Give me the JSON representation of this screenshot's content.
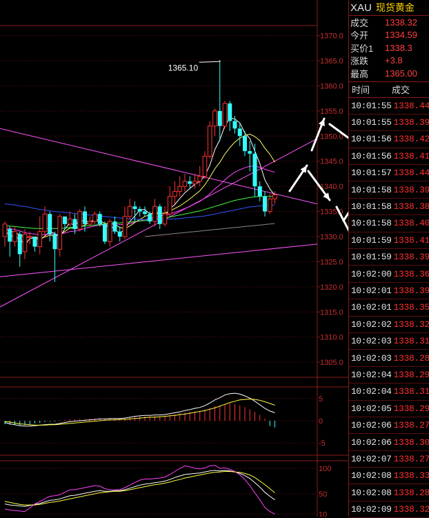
{
  "quote": {
    "symbol": "XAU",
    "name": "现货黄金",
    "rows": [
      {
        "label": "成交",
        "value": "1338.32"
      },
      {
        "label": "今开",
        "value": "1334.59"
      },
      {
        "label": "买价1",
        "value": "1338.3"
      },
      {
        "label": "涨跌",
        "value": "+3.8"
      },
      {
        "label": "最高",
        "value": "1365.00"
      }
    ]
  },
  "ticks": {
    "headers": [
      "时间",
      "成交"
    ],
    "rows": [
      {
        "time": "10:01:55",
        "price": "1338.44"
      },
      {
        "time": "10:01:55",
        "price": "1338.39"
      },
      {
        "time": "10:01:56",
        "price": "1338.42"
      },
      {
        "time": "10:01:56",
        "price": "1338.41"
      },
      {
        "time": "10:01:57",
        "price": "1338.44"
      },
      {
        "time": "10:01:58",
        "price": "1338.39"
      },
      {
        "time": "10:01:58",
        "price": "1338.38"
      },
      {
        "time": "10:01:58",
        "price": "1338.40"
      },
      {
        "time": "10:01:59",
        "price": "1338.41"
      },
      {
        "time": "10:01:59",
        "price": "1338.39"
      },
      {
        "time": "10:02:00",
        "price": "1338.36"
      },
      {
        "time": "10:02:01",
        "price": "1338.39"
      },
      {
        "time": "10:02:01",
        "price": "1338.35"
      },
      {
        "time": "10:02:02",
        "price": "1338.32"
      },
      {
        "time": "10:02:03",
        "price": "1338.31"
      },
      {
        "time": "10:02:03",
        "price": "1338.28"
      },
      {
        "time": "10:02:04",
        "price": "1338.29"
      },
      {
        "time": "10:02:04",
        "price": "1338.31"
      },
      {
        "time": "10:02:05",
        "price": "1338.29"
      },
      {
        "time": "10:02:06",
        "price": "1338.27"
      },
      {
        "time": "10:02:06",
        "price": "1338.30"
      },
      {
        "time": "10:02:07",
        "price": "1338.27"
      },
      {
        "time": "10:02:08",
        "price": "1338.33"
      },
      {
        "time": "10:02:08",
        "price": "1338.28"
      },
      {
        "time": "10:02:09",
        "price": "1338.32"
      }
    ]
  },
  "chart_data": {
    "type": "candlestick",
    "price_axis": {
      "ticks": [
        "1370.0",
        "1365.0",
        "1360.0",
        "1355.0",
        "1350.0",
        "1345.0",
        "1340.0",
        "1335.0",
        "1330.0",
        "1325.0",
        "1320.0",
        "1315.0",
        "1310.0",
        "1305.0"
      ],
      "range": [
        1302,
        1372
      ]
    },
    "high_label": "1365.10",
    "macd_axis": {
      "ticks": [
        "5",
        "0",
        "-5"
      ],
      "range": [
        -7,
        7
      ]
    },
    "kdj_axis": {
      "ticks": [
        "100",
        "50",
        "10"
      ],
      "range": [
        5,
        115
      ]
    },
    "candles": [
      [
        1330.0,
        1332.5,
        1328.0,
        1333.0
      ],
      [
        1331.5,
        1329.0,
        1326.0,
        1332.0
      ],
      [
        1329.0,
        1331.0,
        1328.0,
        1332.0
      ],
      [
        1330.5,
        1326.5,
        1324.0,
        1331.0
      ],
      [
        1327.0,
        1330.5,
        1325.5,
        1331.5
      ],
      [
        1330.0,
        1330.0,
        1328.5,
        1331.0
      ],
      [
        1330.0,
        1328.0,
        1327.0,
        1330.0
      ],
      [
        1328.0,
        1331.0,
        1326.5,
        1334.0
      ],
      [
        1331.0,
        1334.5,
        1330.0,
        1336.0
      ],
      [
        1334.5,
        1330.5,
        1329.0,
        1335.0
      ],
      [
        1330.5,
        1327.5,
        1321.0,
        1331.0
      ],
      [
        1327.5,
        1334.0,
        1326.0,
        1334.5
      ],
      [
        1334.0,
        1332.5,
        1331.5,
        1334.0
      ],
      [
        1332.5,
        1333.5,
        1332.0,
        1335.0
      ],
      [
        1333.5,
        1331.5,
        1330.5,
        1334.5
      ],
      [
        1331.5,
        1335.0,
        1331.0,
        1335.5
      ],
      [
        1335.0,
        1332.5,
        1331.0,
        1336.0
      ],
      [
        1332.5,
        1333.0,
        1332.0,
        1334.0
      ],
      [
        1333.0,
        1334.5,
        1332.5,
        1335.0
      ],
      [
        1334.5,
        1332.5,
        1332.0,
        1335.0
      ],
      [
        1332.5,
        1329.0,
        1328.5,
        1333.0
      ],
      [
        1329.0,
        1333.0,
        1328.0,
        1333.5
      ],
      [
        1333.0,
        1331.0,
        1330.5,
        1334.0
      ],
      [
        1331.0,
        1330.0,
        1329.0,
        1332.0
      ],
      [
        1330.0,
        1334.0,
        1329.5,
        1336.0
      ],
      [
        1334.0,
        1336.0,
        1333.5,
        1337.5
      ],
      [
        1336.0,
        1335.5,
        1333.0,
        1337.0
      ],
      [
        1335.5,
        1335.0,
        1334.0,
        1336.0
      ],
      [
        1335.0,
        1334.5,
        1334.0,
        1336.0
      ],
      [
        1334.5,
        1333.0,
        1332.5,
        1335.0
      ],
      [
        1333.0,
        1336.0,
        1332.0,
        1337.5
      ],
      [
        1336.0,
        1332.5,
        1331.5,
        1336.5
      ],
      [
        1332.5,
        1334.5,
        1332.0,
        1336.0
      ],
      [
        1334.5,
        1338.0,
        1334.0,
        1340.0
      ],
      [
        1338.0,
        1339.0,
        1336.5,
        1341.0
      ],
      [
        1339.0,
        1340.0,
        1338.0,
        1342.0
      ],
      [
        1340.0,
        1341.0,
        1339.0,
        1342.5
      ],
      [
        1341.0,
        1340.5,
        1339.5,
        1342.0
      ],
      [
        1340.5,
        1341.0,
        1339.5,
        1342.5
      ],
      [
        1341.0,
        1342.0,
        1340.0,
        1344.0
      ],
      [
        1342.0,
        1346.0,
        1341.5,
        1347.0
      ],
      [
        1346.0,
        1352.0,
        1345.5,
        1353.0
      ],
      [
        1352.0,
        1355.0,
        1350.0,
        1355.5
      ],
      [
        1355.0,
        1352.0,
        1349.0,
        1365.1
      ],
      [
        1352.0,
        1356.5,
        1351.5,
        1357.0
      ],
      [
        1356.5,
        1353.0,
        1351.0,
        1357.0
      ],
      [
        1353.0,
        1351.5,
        1350.5,
        1354.0
      ],
      [
        1351.5,
        1350.0,
        1348.0,
        1352.5
      ],
      [
        1350.0,
        1347.0,
        1346.0,
        1351.0
      ],
      [
        1347.0,
        1346.5,
        1343.0,
        1349.0
      ],
      [
        1346.5,
        1340.0,
        1338.0,
        1348.5
      ],
      [
        1340.0,
        1338.0,
        1337.0,
        1341.0
      ],
      [
        1338.0,
        1335.0,
        1334.0,
        1339.0
      ],
      [
        1335.0,
        1337.5,
        1334.5,
        1338.5
      ],
      [
        1337.5,
        1338.3,
        1336.5,
        1339.0
      ]
    ],
    "ma_lines": [
      {
        "color": "#ffffff",
        "values": [
          1331.2,
          1330.2,
          1330.0,
          1329.5,
          1328.4,
          1329.6,
          1329.8,
          1329.3,
          1330.1,
          1331.0,
          1330.6,
          1330.0,
          1331.5,
          1332.7,
          1332.2,
          1333.2,
          1333.1,
          1332.9,
          1333.5,
          1333.2,
          1331.8,
          1332.3,
          1331.4,
          1330.6,
          1331.6,
          1333.0,
          1334.1,
          1335.3,
          1335.4,
          1334.5,
          1334.8,
          1334.3,
          1334.1,
          1335.5,
          1336.4,
          1337.6,
          1338.7,
          1339.6,
          1340.4,
          1341.0,
          1342.1,
          1344.2,
          1347.3,
          1349.3,
          1352.0,
          1353.6,
          1353.4,
          1352.6,
          1350.6,
          1349.5,
          1347.0,
          1344.5,
          1341.3,
          1339.5,
          1338.2
        ]
      },
      {
        "color": "#ffff66",
        "values": [
          1331.5,
          1331.2,
          1330.8,
          1330.4,
          1329.9,
          1329.9,
          1329.9,
          1329.6,
          1329.9,
          1330.3,
          1330.1,
          1330.4,
          1331.0,
          1331.7,
          1331.6,
          1331.9,
          1332.3,
          1332.9,
          1333.0,
          1333.2,
          1332.6,
          1332.6,
          1332.4,
          1331.8,
          1331.6,
          1332.1,
          1332.8,
          1333.4,
          1334.0,
          1334.4,
          1334.9,
          1334.6,
          1334.7,
          1335.1,
          1335.6,
          1336.1,
          1336.8,
          1337.5,
          1338.3,
          1339.1,
          1340.3,
          1341.8,
          1343.5,
          1344.8,
          1346.4,
          1347.7,
          1348.8,
          1349.6,
          1350.1,
          1350.4,
          1349.9,
          1349.1,
          1347.6,
          1346.4,
          1344.8
        ]
      },
      {
        "color": "#ff44ff",
        "values": [
          1331.8,
          1331.6,
          1331.4,
          1331.1,
          1330.8,
          1330.6,
          1330.5,
          1330.4,
          1330.4,
          1330.5,
          1330.4,
          1330.5,
          1330.7,
          1331.0,
          1331.1,
          1331.3,
          1331.6,
          1331.9,
          1332.1,
          1332.3,
          1332.3,
          1332.4,
          1332.5,
          1332.4,
          1332.4,
          1332.6,
          1332.9,
          1333.1,
          1333.4,
          1333.6,
          1333.9,
          1334.0,
          1334.2,
          1334.5,
          1334.8,
          1335.2,
          1335.6,
          1336.0,
          1336.5,
          1337.0,
          1337.7,
          1338.5,
          1339.5,
          1340.3,
          1341.3,
          1342.1,
          1342.8,
          1343.3,
          1343.7,
          1344.0,
          1344.0,
          1343.8,
          1343.4,
          1343.1,
          1342.8
        ]
      },
      {
        "color": "#44ff44",
        "values": [
          1332.2,
          1332.1,
          1332.0,
          1331.9,
          1331.8,
          1331.7,
          1331.6,
          1331.6,
          1331.6,
          1331.6,
          1331.6,
          1331.6,
          1331.7,
          1331.8,
          1331.9,
          1332.0,
          1332.1,
          1332.2,
          1332.3,
          1332.4,
          1332.5,
          1332.6,
          1332.7,
          1332.7,
          1332.8,
          1332.9,
          1333.0,
          1333.1,
          1333.2,
          1333.3,
          1333.5,
          1333.6,
          1333.7,
          1333.9,
          1334.1,
          1334.3,
          1334.5,
          1334.7,
          1334.9,
          1335.1,
          1335.4,
          1335.7,
          1336.0,
          1336.3,
          1336.6,
          1336.9,
          1337.2,
          1337.4,
          1337.6,
          1337.8,
          1337.9,
          1338.0,
          1338.0,
          1338.0,
          1338.0
        ]
      },
      {
        "color": "#3355ff",
        "values": [
          1336.5,
          1336.4,
          1336.3,
          1336.1,
          1336.0,
          1335.8,
          1335.6,
          1335.4,
          1335.3,
          1335.1,
          1335.0,
          1334.9,
          1334.8,
          1334.7,
          1334.6,
          1334.5,
          1334.4,
          1334.3,
          1334.2,
          1334.1,
          1334.0,
          1333.9,
          1333.8,
          1333.7,
          1333.6,
          1333.5,
          1333.5,
          1333.4,
          1333.4,
          1333.4,
          1333.4,
          1333.4,
          1333.4,
          1333.5,
          1333.5,
          1333.6,
          1333.7,
          1333.8,
          1333.9,
          1334.0,
          1334.1,
          1334.3,
          1334.5,
          1334.7,
          1334.9,
          1335.1,
          1335.3,
          1335.5,
          1335.7,
          1335.9,
          1336.0,
          1336.1,
          1336.2,
          1336.2,
          1336.3
        ]
      },
      {
        "color": "#888888",
        "values": [
          null,
          null,
          null,
          null,
          null,
          null,
          null,
          null,
          null,
          null,
          null,
          null,
          null,
          null,
          null,
          null,
          null,
          null,
          null,
          null,
          null,
          null,
          null,
          null,
          null,
          null,
          null,
          null,
          1330.0,
          1330.1,
          1330.2,
          1330.3,
          1330.4,
          1330.5,
          1330.6,
          1330.7,
          1330.8,
          1330.9,
          1331.0,
          1331.1,
          1331.2,
          1331.3,
          1331.4,
          1331.5,
          1331.6,
          1331.7,
          1331.8,
          1331.9,
          1332.0,
          1332.1,
          1332.2,
          1332.3,
          1332.4,
          1332.5,
          1332.6
        ]
      }
    ],
    "macd_hist": [
      -0.8,
      -0.9,
      -1.0,
      -1.1,
      -1.0,
      -0.8,
      -0.6,
      -0.5,
      -0.3,
      -0.2,
      -0.2,
      0.1,
      0.2,
      0.3,
      0.3,
      0.4,
      0.4,
      0.5,
      0.5,
      0.6,
      0.5,
      0.6,
      0.6,
      0.5,
      0.6,
      0.8,
      0.9,
      1.0,
      1.0,
      1.0,
      1.1,
      1.0,
      1.1,
      1.3,
      1.5,
      1.7,
      1.9,
      2.0,
      2.1,
      2.2,
      2.5,
      2.9,
      3.3,
      3.5,
      3.8,
      3.9,
      3.8,
      3.5,
      3.1,
      2.6,
      2.0,
      1.3,
      0.5,
      -1.2,
      -1.5
    ],
    "macd_dif": [
      -0.4,
      -0.7,
      -0.9,
      -1.1,
      -1.2,
      -1.2,
      -1.1,
      -1.0,
      -0.9,
      -0.8,
      -0.8,
      -0.6,
      -0.4,
      -0.2,
      -0.1,
      0.0,
      0.1,
      0.2,
      0.3,
      0.4,
      0.4,
      0.5,
      0.5,
      0.5,
      0.6,
      0.8,
      1.0,
      1.1,
      1.2,
      1.2,
      1.3,
      1.3,
      1.4,
      1.6,
      1.8,
      2.0,
      2.3,
      2.5,
      2.8,
      3.0,
      3.4,
      4.0,
      4.7,
      5.2,
      5.8,
      6.1,
      6.2,
      6.0,
      5.6,
      5.1,
      4.4,
      3.6,
      2.8,
      2.2,
      1.8
    ],
    "macd_dea": [
      -0.2,
      -0.3,
      -0.5,
      -0.7,
      -0.8,
      -0.9,
      -1.0,
      -1.0,
      -1.0,
      -0.9,
      -0.9,
      -0.8,
      -0.7,
      -0.6,
      -0.5,
      -0.4,
      -0.3,
      -0.2,
      -0.1,
      0.0,
      0.1,
      0.2,
      0.2,
      0.3,
      0.3,
      0.4,
      0.5,
      0.6,
      0.7,
      0.8,
      0.8,
      0.9,
      1.0,
      1.1,
      1.2,
      1.4,
      1.5,
      1.7,
      1.9,
      2.1,
      2.3,
      2.6,
      2.9,
      3.3,
      3.7,
      4.1,
      4.4,
      4.7,
      4.8,
      4.9,
      4.8,
      4.6,
      4.3,
      3.9,
      3.5
    ],
    "kdj_k": [
      30,
      28,
      27,
      26,
      25,
      27,
      29,
      31,
      34,
      37,
      38,
      40,
      43,
      46,
      47,
      49,
      51,
      53,
      55,
      56,
      55,
      55,
      56,
      56,
      58,
      61,
      64,
      67,
      69,
      70,
      72,
      73,
      75,
      78,
      82,
      85,
      88,
      89,
      90,
      91,
      93,
      95,
      96,
      95,
      96,
      95,
      93,
      90,
      86,
      80,
      72,
      63,
      53,
      45,
      38
    ],
    "kdj_d": [
      35,
      33,
      31,
      29,
      28,
      28,
      28,
      29,
      31,
      33,
      34,
      36,
      38,
      40,
      42,
      44,
      46,
      48,
      50,
      52,
      53,
      54,
      55,
      55,
      56,
      58,
      60,
      62,
      64,
      66,
      68,
      69,
      71,
      73,
      76,
      78,
      81,
      83,
      85,
      87,
      89,
      91,
      92,
      93,
      94,
      94,
      93,
      92,
      90,
      87,
      82,
      75,
      68,
      60,
      52
    ],
    "kdj_j": [
      20,
      18,
      17,
      16,
      15,
      22,
      30,
      35,
      40,
      45,
      46,
      48,
      53,
      58,
      58,
      60,
      62,
      64,
      66,
      65,
      60,
      58,
      58,
      58,
      62,
      67,
      72,
      77,
      79,
      79,
      80,
      81,
      83,
      88,
      94,
      100,
      105,
      103,
      100,
      99,
      101,
      105,
      106,
      100,
      101,
      98,
      94,
      87,
      78,
      66,
      52,
      38,
      23,
      15,
      10
    ]
  }
}
